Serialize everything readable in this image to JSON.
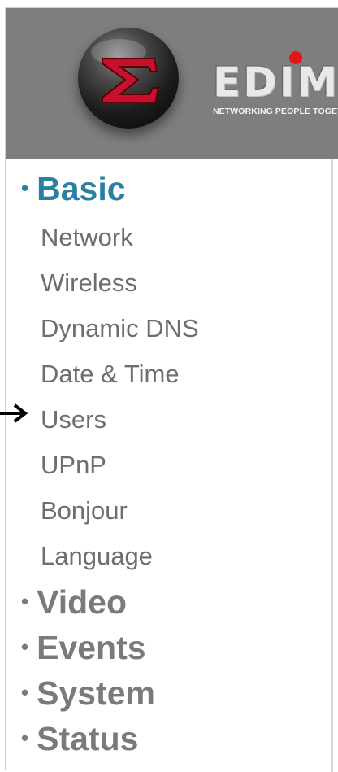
{
  "brand": {
    "name": "EDIMAX",
    "tagline": "NETWORKING PEOPLE TOGETHER",
    "dot_color": "#e3141b",
    "logo_color": "#c8102e"
  },
  "menu": {
    "sections": [
      {
        "label": "Basic",
        "bullet": "•",
        "active": true,
        "items": [
          {
            "label": "Network"
          },
          {
            "label": "Wireless"
          },
          {
            "label": "Dynamic DNS"
          },
          {
            "label": "Date & Time"
          },
          {
            "label": "Users"
          },
          {
            "label": "UPnP"
          },
          {
            "label": "Bonjour"
          },
          {
            "label": "Language"
          }
        ]
      },
      {
        "label": "Video",
        "bullet": "•",
        "active": false
      },
      {
        "label": "Events",
        "bullet": "•",
        "active": false
      },
      {
        "label": "System",
        "bullet": "•",
        "active": false
      },
      {
        "label": "Status",
        "bullet": "•",
        "active": false
      }
    ]
  },
  "annotation": {
    "arrow_target": "Users",
    "arrow_icon": "arrow-right-icon"
  },
  "colors": {
    "header_bg": "#7e7e7e",
    "active_section": "#2a7fa3",
    "inactive_section": "#7a7a7a",
    "item_text": "#6e6e6e"
  }
}
